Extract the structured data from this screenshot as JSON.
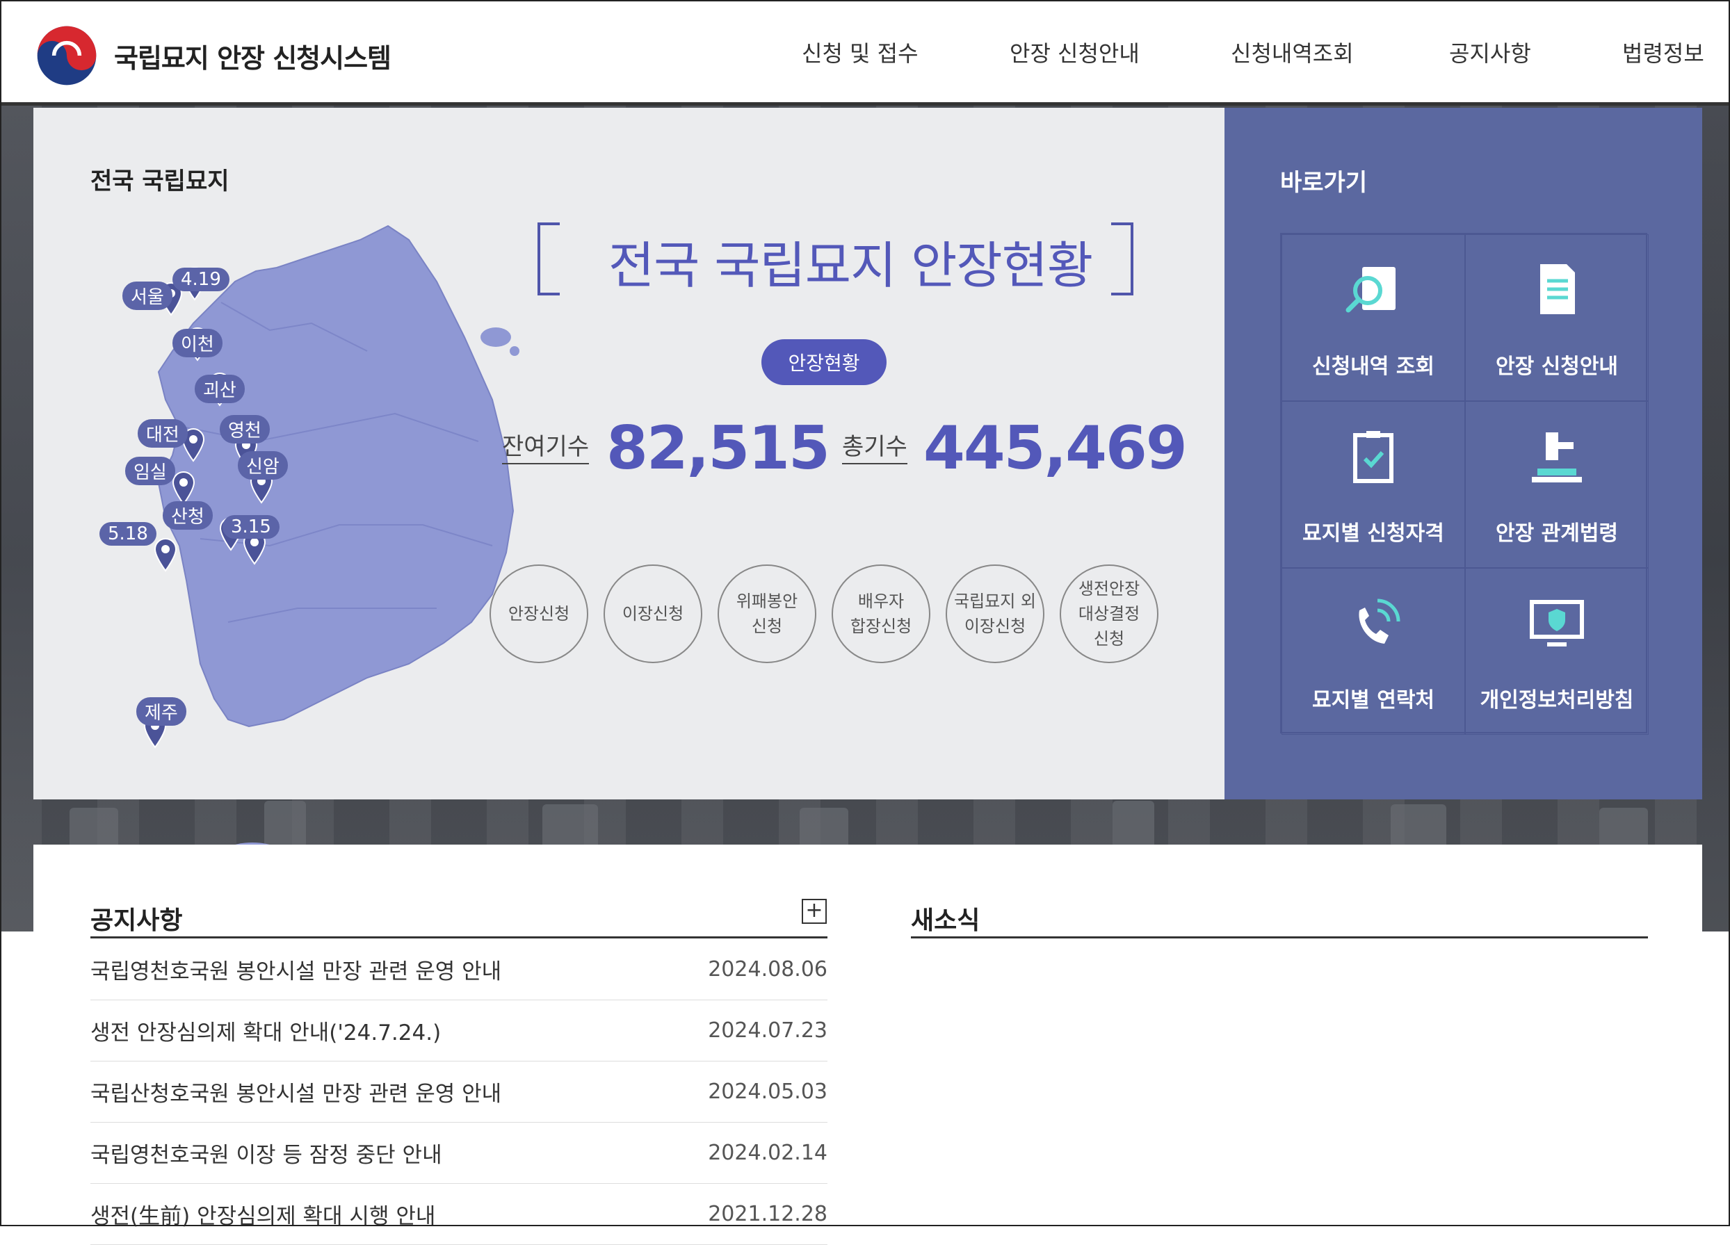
{
  "header": {
    "site_title": "국립묘지 안장 신청시스템",
    "nav": [
      "신청 및 접수",
      "안장 신청안내",
      "신청내역조회",
      "공지사항",
      "법령정보"
    ]
  },
  "map_panel": {
    "title": "전국 국립묘지",
    "cemeteries": [
      "4.19",
      "서울",
      "이천",
      "괴산",
      "대전",
      "영천",
      "임실",
      "신암",
      "산청",
      "3.15",
      "5.18",
      "제주"
    ],
    "status_title": "전국 국립묘지 안장현황",
    "status_pill": "안장현황",
    "remaining_label": "잔여기수",
    "remaining_value": "82,515",
    "total_label": "총기수",
    "total_value": "445,469",
    "actions": [
      "안장신청",
      "이장신청",
      "위패봉안\n신청",
      "배우자\n합장신청",
      "국립묘지 외\n이장신청",
      "생전안장\n대상결정\n신청"
    ]
  },
  "quick_links": {
    "title": "바로가기",
    "items": [
      {
        "label": "신청내역 조회",
        "icon": "search-document-icon"
      },
      {
        "label": "안장 신청안내",
        "icon": "document-icon"
      },
      {
        "label": "묘지별 신청자격",
        "icon": "checklist-icon"
      },
      {
        "label": "안장 관계법령",
        "icon": "gavel-icon"
      },
      {
        "label": "묘지별 연락처",
        "icon": "phone-icon"
      },
      {
        "label": "개인정보처리방침",
        "icon": "monitor-shield-icon"
      }
    ]
  },
  "notices": {
    "title": "공지사항",
    "more": "+",
    "items": [
      {
        "text": "국립영천호국원 봉안시설 만장 관련 운영 안내",
        "date": "2024.08.06"
      },
      {
        "text": "생전 안장심의제 확대 안내('24.7.24.)",
        "date": "2024.07.23"
      },
      {
        "text": "국립산청호국원 봉안시설 만장 관련 운영 안내",
        "date": "2024.05.03"
      },
      {
        "text": "국립영천호국원 이장 등 잠정 중단 안내",
        "date": "2024.02.14"
      },
      {
        "text": "생전(生前) 안장심의제 확대 시행 안내",
        "date": "2021.12.28"
      }
    ]
  },
  "news": {
    "title": "새소식"
  },
  "colors": {
    "accent": "#5358b9",
    "panel": "#5b68a0",
    "map": "#8f98d4"
  }
}
